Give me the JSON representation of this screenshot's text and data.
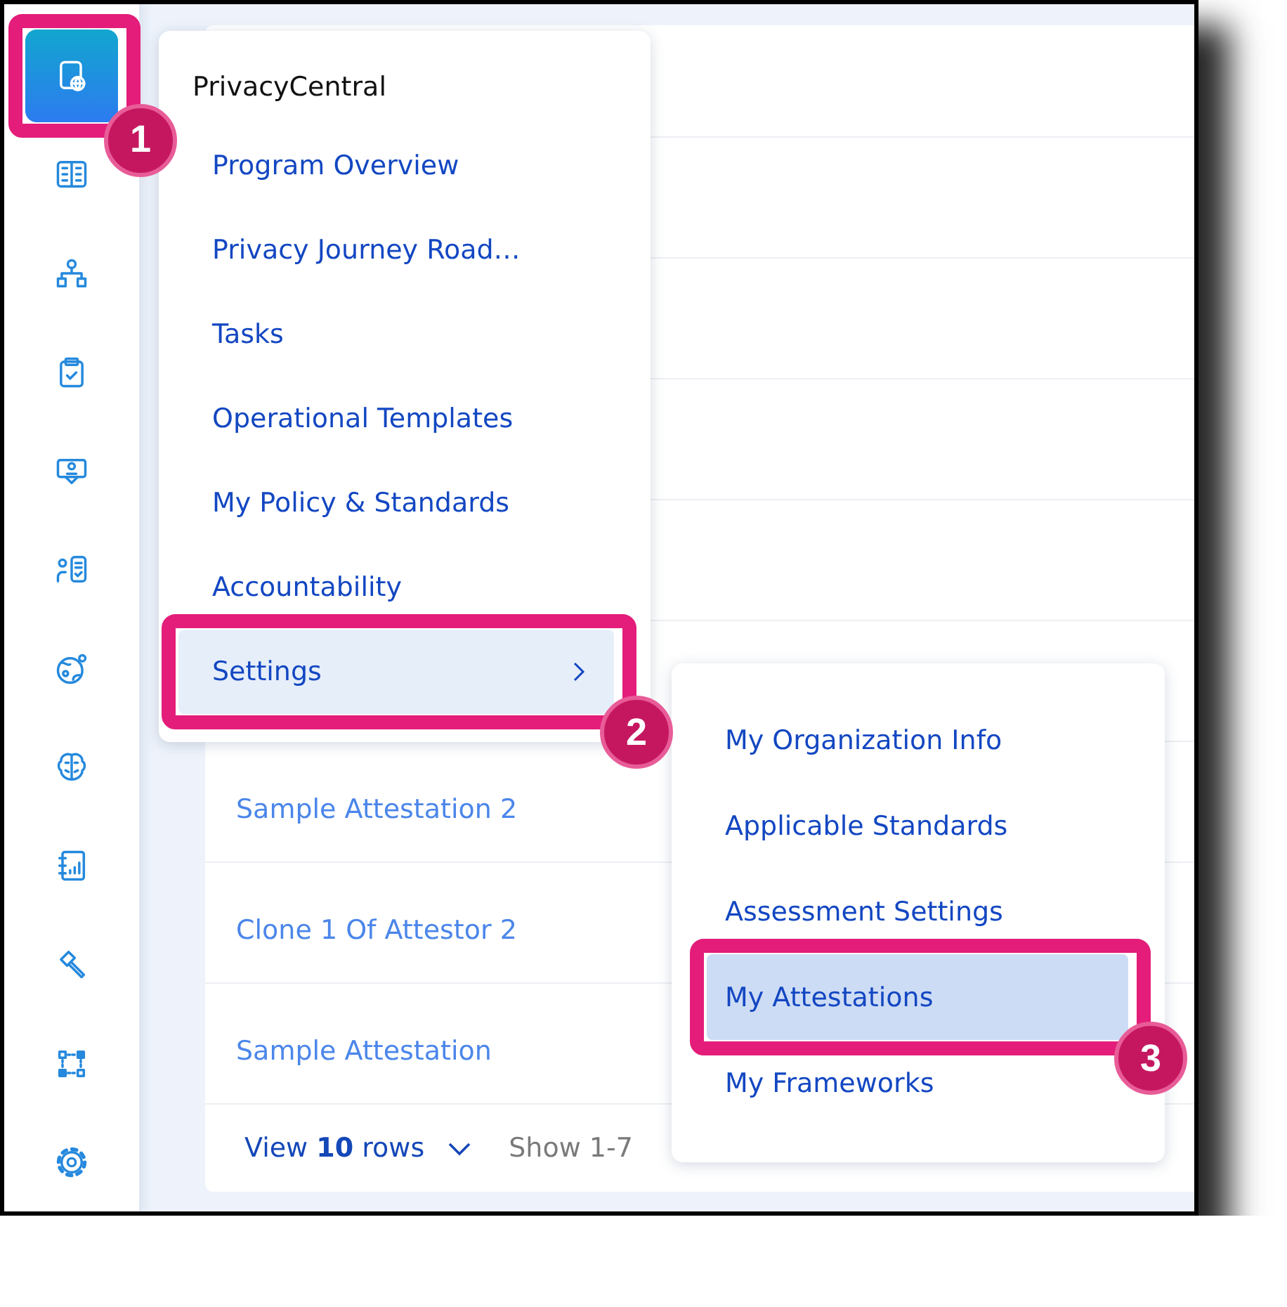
{
  "sidebar": {
    "items": [
      {
        "kind": "globe-page",
        "selected": true,
        "annotation": "1"
      },
      {
        "kind": "book",
        "selected": false
      },
      {
        "kind": "hierarchy",
        "selected": false
      },
      {
        "kind": "clipboard-check",
        "selected": false
      },
      {
        "kind": "presentation",
        "selected": false
      },
      {
        "kind": "person-list",
        "selected": false
      },
      {
        "kind": "planet",
        "selected": false
      },
      {
        "kind": "brain",
        "selected": false
      },
      {
        "kind": "report",
        "selected": false
      },
      {
        "kind": "gavel",
        "selected": false
      },
      {
        "kind": "flow",
        "selected": false
      },
      {
        "kind": "gear",
        "selected": false
      }
    ]
  },
  "menu": {
    "title": "PrivacyCentral",
    "items": [
      {
        "label": "Program Overview",
        "selected": false,
        "has_submenu": false
      },
      {
        "label": "Privacy Journey Road…",
        "selected": false,
        "has_submenu": false
      },
      {
        "label": "Tasks",
        "selected": false,
        "has_submenu": false
      },
      {
        "label": "Operational Templates",
        "selected": false,
        "has_submenu": false
      },
      {
        "label": "My Policy & Standards",
        "selected": false,
        "has_submenu": false
      },
      {
        "label": "Accountability",
        "selected": false,
        "has_submenu": false
      },
      {
        "label": "Settings",
        "selected": true,
        "has_submenu": true,
        "annotation": "2"
      }
    ]
  },
  "submenu": {
    "items": [
      {
        "label": "My Organization Info",
        "selected": false
      },
      {
        "label": "Applicable Standards",
        "selected": false
      },
      {
        "label": "Assessment Settings",
        "selected": false
      },
      {
        "label": "My Attestations",
        "selected": true,
        "annotation": "3"
      },
      {
        "label": "My Frameworks",
        "selected": false
      }
    ]
  },
  "table": {
    "rows": [
      {
        "name": "Sample Attestation 2"
      },
      {
        "name": "Clone 1 Of Attestor 2"
      },
      {
        "name": "Sample Attestation"
      }
    ],
    "footer": {
      "page_size": "View **10** rows",
      "range": "Show 1-7"
    }
  }
}
